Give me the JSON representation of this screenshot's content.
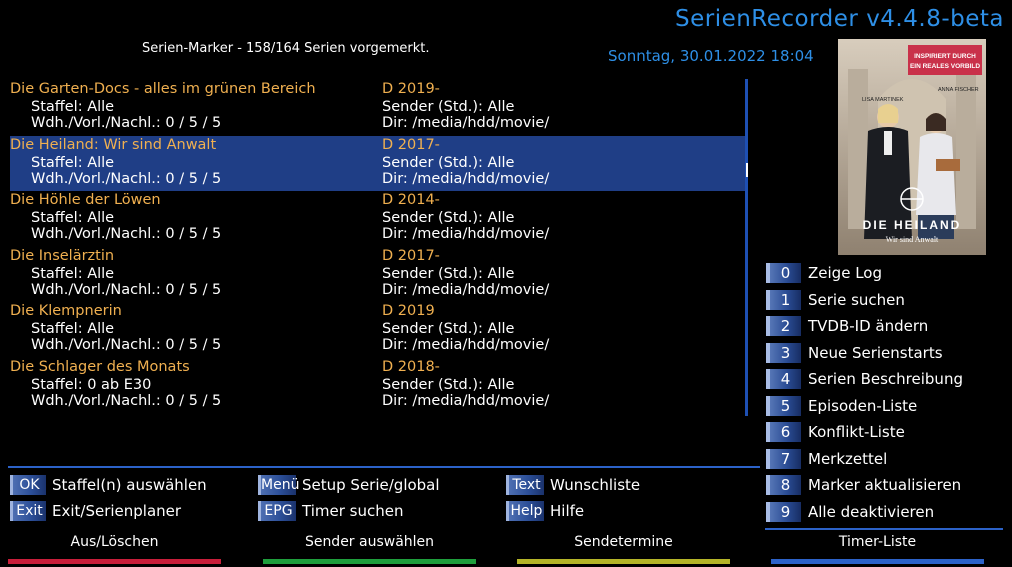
{
  "header": {
    "app_title": "SerienRecorder v4.4.8-beta",
    "status": "Serien-Marker - 158/164 Serien vorgemerkt.",
    "datetime": "Sonntag, 30.01.2022  18:04"
  },
  "poster": {
    "tagline_line1": "INSPIRIERT DURCH",
    "tagline_line2": "EIN REALES VORBILD",
    "actor_left": "LISA MARTINEK",
    "actor_right": "ANNA FISCHER",
    "title": "DIE HEILAND",
    "subtitle": "Wir sind Anwalt"
  },
  "series": [
    {
      "name": "Die Garten-Docs - alles im grünen Bereich",
      "staffel": "Staffel: Alle",
      "wdh": "Wdh./Vorl./Nachl.: 0 / 5 / 5",
      "year": "D 2019-",
      "sender": "Sender (Std.): Alle",
      "dir": "Dir: /media/hdd/movie/"
    },
    {
      "name": "Die Heiland: Wir sind Anwalt",
      "staffel": "Staffel: Alle",
      "wdh": "Wdh./Vorl./Nachl.: 0 / 5 / 5",
      "year": "D 2017-",
      "sender": "Sender (Std.): Alle",
      "dir": "Dir: /media/hdd/movie/"
    },
    {
      "name": "Die Höhle der Löwen",
      "staffel": "Staffel: Alle",
      "wdh": "Wdh./Vorl./Nachl.: 0 / 5 / 5",
      "year": "D 2014-",
      "sender": "Sender (Std.): Alle",
      "dir": "Dir: /media/hdd/movie/"
    },
    {
      "name": "Die Inselärztin",
      "staffel": "Staffel: Alle",
      "wdh": "Wdh./Vorl./Nachl.: 0 / 5 / 5",
      "year": "D 2017-",
      "sender": "Sender (Std.): Alle",
      "dir": "Dir: /media/hdd/movie/"
    },
    {
      "name": "Die Klempnerin",
      "staffel": "Staffel: Alle",
      "wdh": "Wdh./Vorl./Nachl.: 0 / 5 / 5",
      "year": "D 2019",
      "sender": "Sender (Std.): Alle",
      "dir": "Dir: /media/hdd/movie/"
    },
    {
      "name": "Die Schlager des Monats",
      "staffel": "Staffel: 0 ab E30",
      "wdh": "Wdh./Vorl./Nachl.: 0 / 5 / 5",
      "year": "D 2018-",
      "sender": "Sender (Std.): Alle",
      "dir": "Dir: /media/hdd/movie/"
    }
  ],
  "selected_index": 1,
  "keys": [
    {
      "cap": "OK",
      "label": "Staffel(n) auswählen"
    },
    {
      "cap": "Menü",
      "label": "Setup Serie/global"
    },
    {
      "cap": "Text",
      "label": "Wunschliste"
    },
    {
      "cap": "Exit",
      "label": "Exit/Serienplaner"
    },
    {
      "cap": "EPG",
      "label": "Timer suchen"
    },
    {
      "cap": "Help",
      "label": "Hilfe"
    }
  ],
  "number_menu": [
    {
      "key": "0",
      "label": "Zeige Log"
    },
    {
      "key": "1",
      "label": "Serie suchen"
    },
    {
      "key": "2",
      "label": "TVDB-ID ändern"
    },
    {
      "key": "3",
      "label": "Neue Serienstarts"
    },
    {
      "key": "4",
      "label": "Serien Beschreibung"
    },
    {
      "key": "5",
      "label": "Episoden-Liste"
    },
    {
      "key": "6",
      "label": "Konflikt-Liste"
    },
    {
      "key": "7",
      "label": "Merkzettel"
    },
    {
      "key": "8",
      "label": "Marker aktualisieren"
    },
    {
      "key": "9",
      "label": "Alle deaktivieren"
    }
  ],
  "color_buttons": [
    {
      "label": "Aus/Löschen",
      "color": "#c81e3a"
    },
    {
      "label": "Sender auswählen",
      "color": "#1e9e3c"
    },
    {
      "label": "Sendetermine",
      "color": "#b4b428"
    },
    {
      "label": "Timer-Liste",
      "color": "#2c62c8"
    }
  ],
  "colors": {
    "accent_blue": "#2e8fe6",
    "series_name": "#f0b050",
    "selection": "#1f3e86"
  }
}
